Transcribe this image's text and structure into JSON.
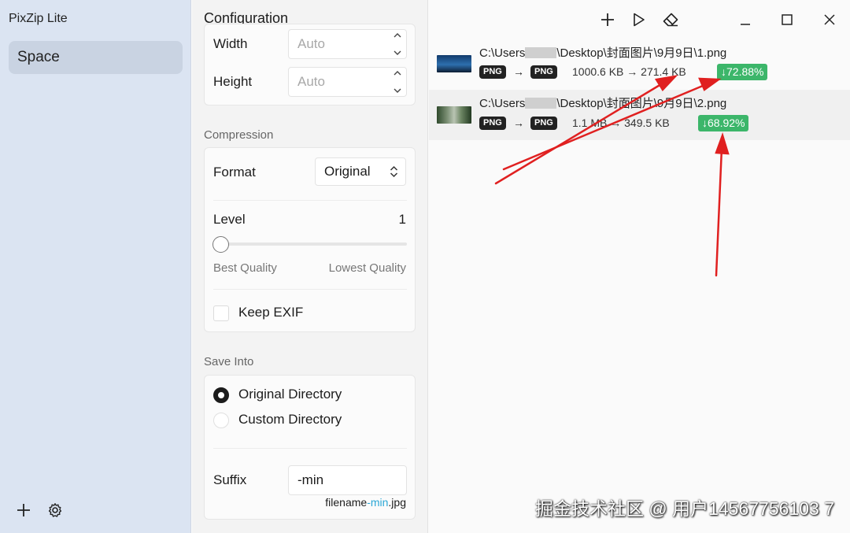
{
  "app": {
    "title": "PixZip Lite"
  },
  "sidebar": {
    "items": [
      {
        "label": "Space"
      }
    ]
  },
  "config": {
    "title": "Configuration",
    "resize": {
      "width_label": "Width",
      "width_placeholder": "Auto",
      "height_label": "Height",
      "height_placeholder": "Auto"
    },
    "compression": {
      "section_label": "Compression",
      "format_label": "Format",
      "format_value": "Original",
      "level_label": "Level",
      "level_value": "1",
      "best_label": "Best Quality",
      "lowest_label": "Lowest Quality",
      "keep_exif_label": "Keep EXIF"
    },
    "save": {
      "section_label": "Save Into",
      "option_original": "Original Directory",
      "option_custom": "Custom Directory",
      "suffix_label": "Suffix",
      "suffix_value": "-min",
      "hint_prefix": "filename",
      "hint_accent": "-min",
      "hint_suffix": ".jpg"
    }
  },
  "files": [
    {
      "path_prefix": "C:\\Users",
      "path_suffix": "\\Desktop\\封面图片\\9月9日\\1.png",
      "from_format": "PNG",
      "to_format": "PNG",
      "original_size": "1000.6 KB",
      "compressed_size": "271.4 KB",
      "reduction": "↓72.88%"
    },
    {
      "path_prefix": "C:\\Users",
      "path_suffix": "\\Desktop\\封面图片\\9月9日\\2.png",
      "from_format": "PNG",
      "to_format": "PNG",
      "original_size": "1.1 MB",
      "compressed_size": "349.5 KB",
      "reduction": "↓68.92%"
    }
  ],
  "colors": {
    "sidebar_bg": "#dbe4f2",
    "accent_green": "#3cb66a",
    "annotation_red": "#e02020",
    "hint_accent": "#2aa7d6"
  },
  "icons": [
    "add-icon",
    "gear-icon",
    "play-icon",
    "eraser-icon",
    "minimize-icon",
    "maximize-icon",
    "close-icon",
    "chevron-up-icon",
    "chevron-down-icon",
    "updown-icon"
  ],
  "watermark": "掘金技术社区 @ 用户14567756103 7"
}
